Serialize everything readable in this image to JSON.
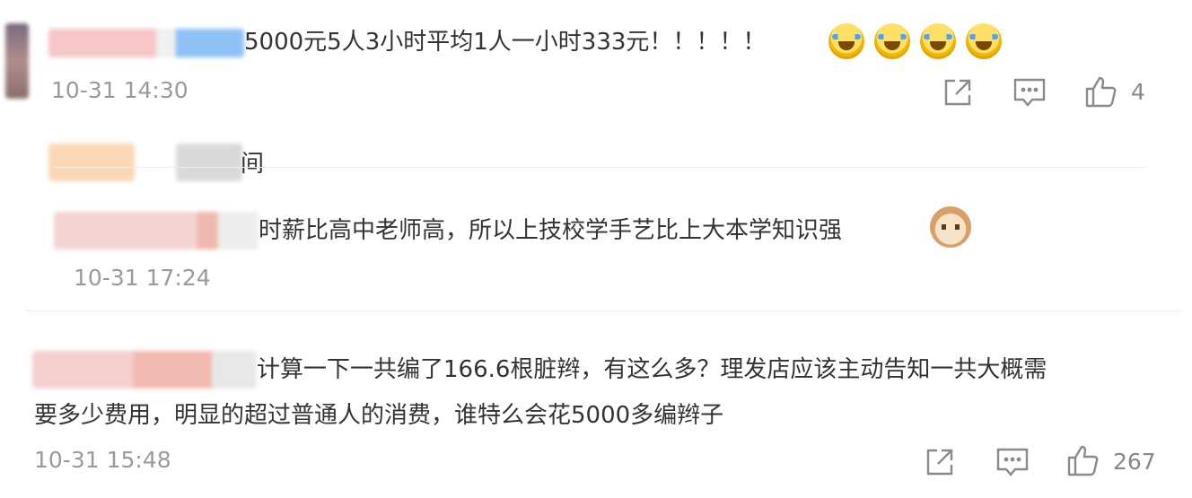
{
  "comment1": {
    "text": "5000元5人3小时平均1人一小时333元！！！！！",
    "time": "10-31 14:30",
    "like_count": "4",
    "emojis": [
      "crying-laughing-emoji",
      "crying-laughing-emoji",
      "crying-laughing-emoji",
      "crying-laughing-emoji"
    ]
  },
  "reply1": {
    "text_fragment": "间"
  },
  "reply2": {
    "text": "时薪比高中老师高，所以上技校学手艺比上大本学知识强",
    "time": "10-31 17:24",
    "emoji": "cat-emoji"
  },
  "comment2": {
    "line1": "计算一下一共编了166.6根脏辫，有这么多？理发店应该主动告知一共大概需",
    "line2": "要多少费用，明显的超过普通人的消费，谁特么会花5000多编辫子",
    "time": "10-31 15:48",
    "like_count": "267"
  },
  "icons": {
    "share": "share-icon",
    "comment": "comment-icon",
    "like": "thumbs-up-icon"
  },
  "colors": {
    "text": "#333333",
    "timestamp": "#9a9a9a",
    "icon": "#8a8a8a",
    "divider": "#eeeeee"
  }
}
